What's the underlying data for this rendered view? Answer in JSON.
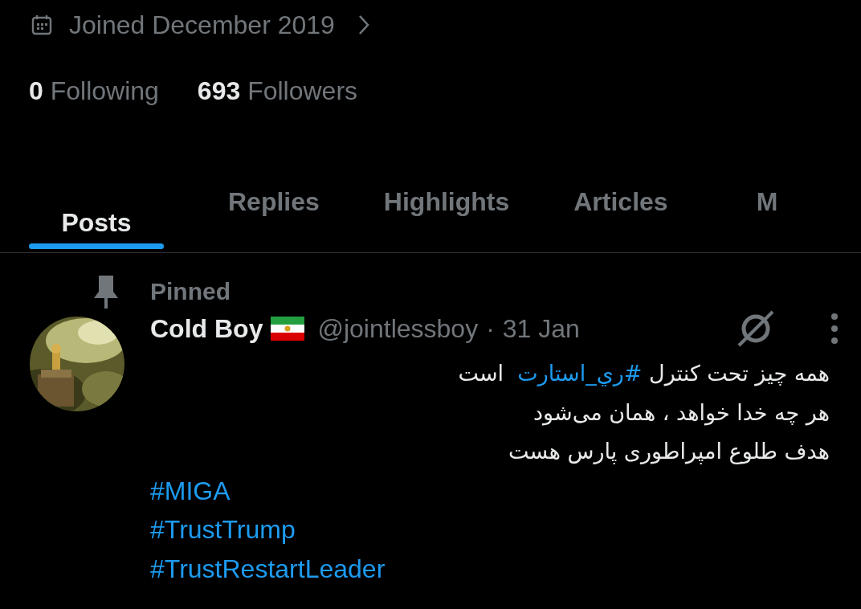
{
  "profile": {
    "joined": "Joined December 2019",
    "following_count": "0",
    "following_label": "Following",
    "followers_count": "693",
    "followers_label": "Followers"
  },
  "tabs": [
    {
      "label": "Posts",
      "selected": true
    },
    {
      "label": "Replies",
      "selected": false
    },
    {
      "label": "Highlights",
      "selected": false
    },
    {
      "label": "Articles",
      "selected": false
    },
    {
      "label": "M",
      "selected": false
    }
  ],
  "post": {
    "pinned_label": "Pinned",
    "author": "Cold Boy",
    "handle": "@jointlessboy",
    "separator": "·",
    "date": "31 Jan",
    "rtl_lines": [
      [
        {
          "kind": "text",
          "text": "همه چیز تحت کنترل "
        },
        {
          "kind": "hashtag",
          "text": "#ري_استارت"
        },
        {
          "kind": "text",
          "text": "  است"
        }
      ],
      [
        {
          "kind": "text",
          "text": "هر چه خدا خواهد ، همان می‌شود"
        }
      ],
      [
        {
          "kind": "text",
          "text": "هدف طلوع امپراطوری پارس هست"
        }
      ]
    ],
    "hashtags": [
      "#MIGA",
      "#TrustTrump",
      "#TrustRestartLeader"
    ]
  }
}
